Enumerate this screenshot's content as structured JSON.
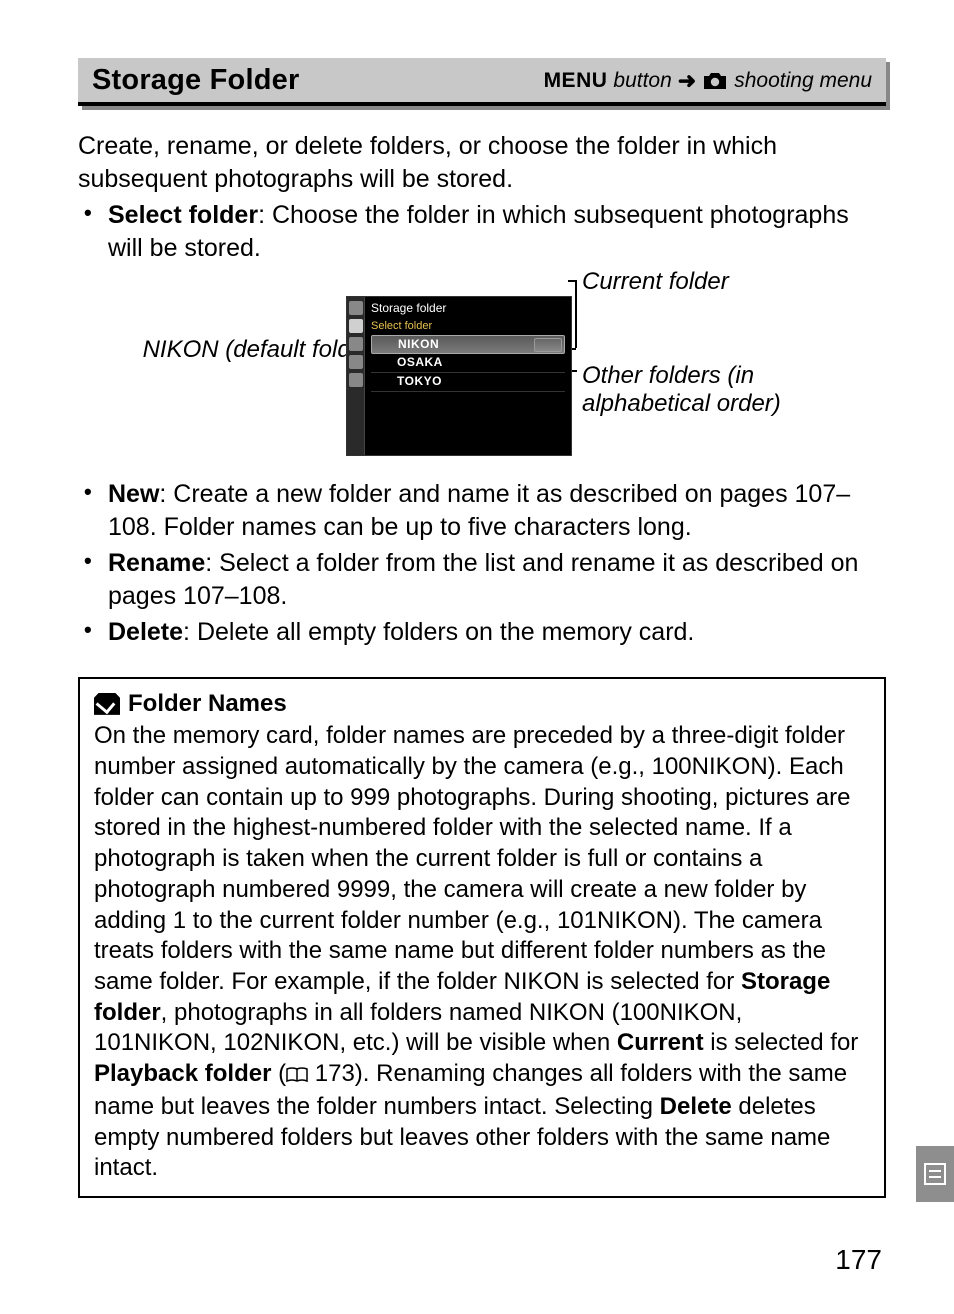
{
  "header": {
    "title": "Storage Folder",
    "menu_word": "MENU",
    "button_word": "button",
    "arrow": "➜",
    "trail": "shooting menu"
  },
  "intro": "Create, rename, or delete folders, or choose the folder in which subsequent photographs will be stored.",
  "bullets": {
    "select": {
      "label": "Select folder",
      "text": ": Choose the folder in which subsequent photographs will be stored."
    },
    "new": {
      "label": "New",
      "text": ": Create a new folder and name it as described on pages 107–108.  Folder names can be up to five characters long."
    },
    "rename": {
      "label": "Rename",
      "text": ": Select a folder from the list and rename it as described on pages 107–108."
    },
    "delete": {
      "label": "Delete",
      "text": ": Delete all empty folders on the memory card."
    }
  },
  "figure": {
    "label_nikon": "NIKON (default folder)",
    "label_current": "Current folder",
    "label_other": "Other folders (in alphabetical order)",
    "screen": {
      "title": "Storage folder",
      "subtitle": "Select folder",
      "rows": [
        "NIKON",
        "OSAKA",
        "TOKYO"
      ]
    }
  },
  "note": {
    "title": "Folder Names",
    "p1": "On the memory card, folder names are preceded by a three-digit folder number assigned automatically by the camera (e.g., 100NIKON).  Each folder can contain up to 999 photographs.  During shooting, pictures are stored in the highest-numbered folder with the selected name.  If a photograph is taken when the current folder is full or contains a photograph numbered 9999, the camera will create a new folder by adding 1 to the current folder number (e.g., 101NIKON).  The camera treats folders with the same name but different folder numbers as the same folder.  For example, if the folder NIKON is selected for ",
    "b1": "Storage folder",
    "p2": ", photographs in all folders named NIKON (100NIKON, 101NIKON, 102NIKON, etc.) will be visible when ",
    "b2": "Current",
    "p3": " is selected for ",
    "b3": "Playback folder",
    "p4": " (",
    "ref": " 173).  Renaming changes all folders with the same name but leaves the folder numbers intact.  Selecting ",
    "b4": "Delete",
    "p5": " deletes empty numbered folders but leaves other folders with the same name intact."
  },
  "page_number": "177"
}
